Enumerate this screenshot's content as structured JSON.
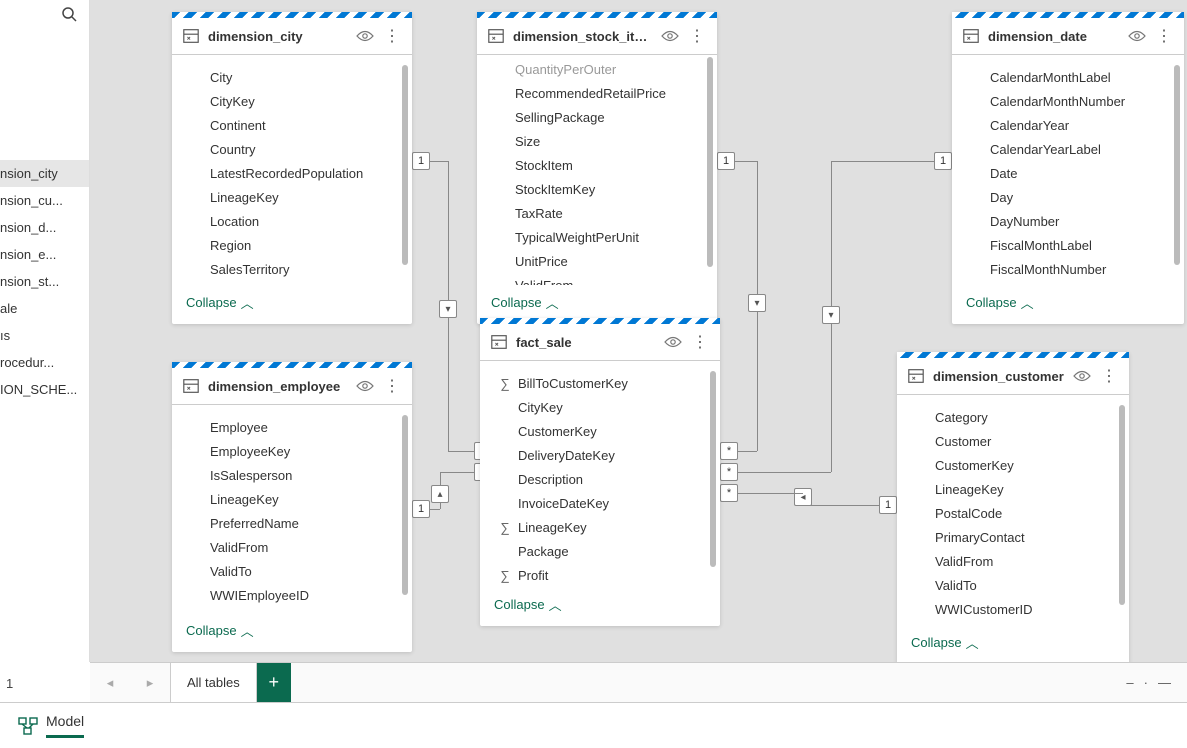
{
  "sidebar": {
    "items": [
      {
        "label": "nsion_city",
        "selected": true
      },
      {
        "label": "nsion_cu..."
      },
      {
        "label": "nsion_d..."
      },
      {
        "label": "nsion_e..."
      },
      {
        "label": "nsion_st..."
      },
      {
        "label": "ale"
      },
      {
        "label": "ıs"
      },
      {
        "label": "rocedur..."
      },
      {
        "label": "ION_SCHE..."
      }
    ]
  },
  "tables": {
    "dimension_city": {
      "title": "dimension_city",
      "fields": [
        "City",
        "CityKey",
        "Continent",
        "Country",
        "LatestRecordedPopulation",
        "LineageKey",
        "Location",
        "Region",
        "SalesTerritory"
      ],
      "collapse": "Collapse"
    },
    "dimension_stock_item": {
      "title": "dimension_stock_item",
      "fields": [
        "QuantityPerOuter",
        "RecommendedRetailPrice",
        "SellingPackage",
        "Size",
        "StockItem",
        "StockItemKey",
        "TaxRate",
        "TypicalWeightPerUnit",
        "UnitPrice",
        "ValidFrom"
      ],
      "collapse": "Collapse",
      "firstCut": true
    },
    "dimension_date": {
      "title": "dimension_date",
      "fields": [
        "CalendarMonthLabel",
        "CalendarMonthNumber",
        "CalendarYear",
        "CalendarYearLabel",
        "Date",
        "Day",
        "DayNumber",
        "FiscalMonthLabel",
        "FiscalMonthNumber"
      ],
      "collapse": "Collapse"
    },
    "dimension_employee": {
      "title": "dimension_employee",
      "fields": [
        "Employee",
        "EmployeeKey",
        "IsSalesperson",
        "LineageKey",
        "PreferredName",
        "ValidFrom",
        "ValidTo",
        "WWIEmployeeID"
      ],
      "collapse": "Collapse"
    },
    "fact_sale": {
      "title": "fact_sale",
      "fields": [
        {
          "name": "BillToCustomerKey",
          "sigma": true
        },
        {
          "name": "CityKey"
        },
        {
          "name": "CustomerKey"
        },
        {
          "name": "DeliveryDateKey"
        },
        {
          "name": "Description"
        },
        {
          "name": "InvoiceDateKey"
        },
        {
          "name": "LineageKey",
          "sigma": true
        },
        {
          "name": "Package"
        },
        {
          "name": "Profit",
          "sigma": true
        }
      ],
      "collapse": "Collapse"
    },
    "dimension_customer": {
      "title": "dimension_customer",
      "fields": [
        "Category",
        "Customer",
        "CustomerKey",
        "LineageKey",
        "PostalCode",
        "PrimaryContact",
        "ValidFrom",
        "ValidTo",
        "WWICustomerID"
      ],
      "collapse": "Collapse"
    }
  },
  "tabs": {
    "active": "All tables",
    "add": "+"
  },
  "bottom": {
    "model": "Model"
  },
  "leftCount": "1",
  "cardinality": {
    "one": "1",
    "many": "*"
  },
  "icons": {
    "eye": "👁",
    "dots": "⋮",
    "chevUp": "︿",
    "down": "▾",
    "right": "▸",
    "left": "◂",
    "minus": "—",
    "dash": "–"
  }
}
